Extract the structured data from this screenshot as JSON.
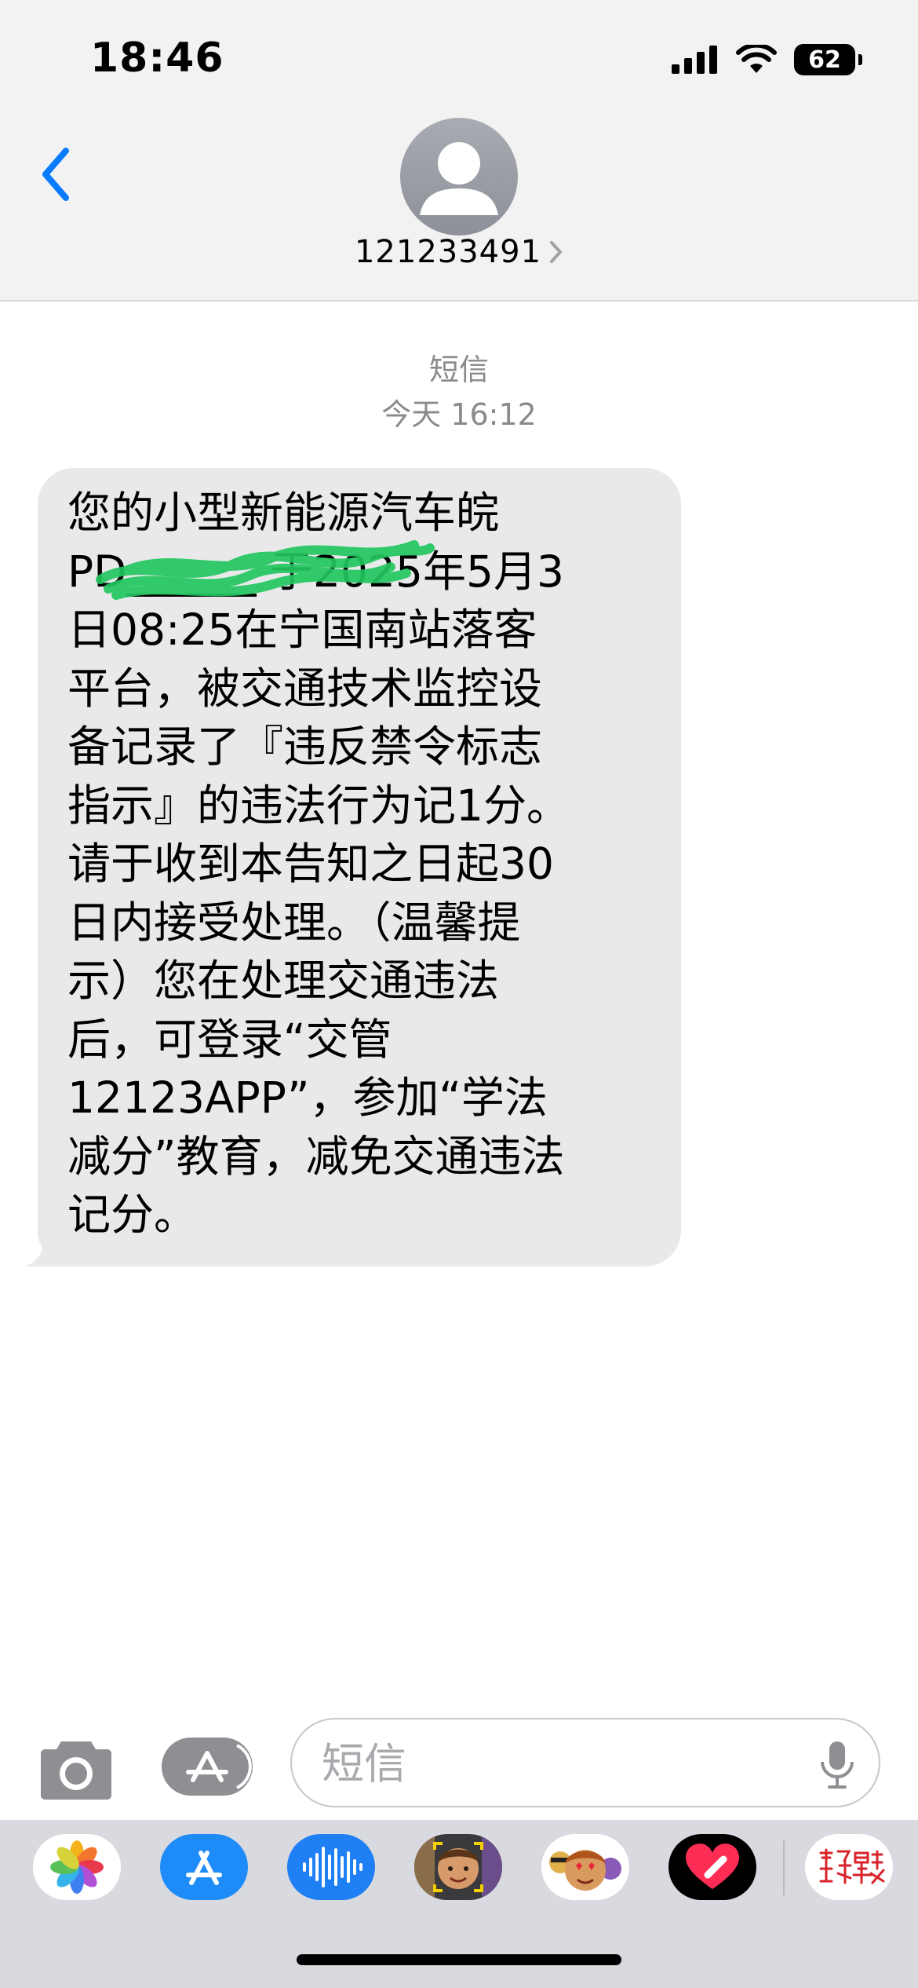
{
  "status_bar": {
    "time": "18:46",
    "battery_level": "62"
  },
  "nav": {
    "contact_number": "121233491"
  },
  "thread": {
    "service_label": "短信",
    "timestamp": "今天 16:12",
    "message": {
      "lines": [
        "您的小型新能源汽车皖",
        "PD______ 于2025年5月3",
        "日08:25在宁国南站落客",
        "平台，被交通技术监控设",
        "备记录了『违反禁令标志",
        "指示』的违法行为记1分。",
        "请于收到本告知之日起30",
        "日内接受处理。（温馨提",
        "示）您在处理交通违法",
        "后，可登录“交管",
        "12123APP”，参加“学法",
        "减分”教育，减免交通违法",
        "记分。"
      ]
    }
  },
  "composer": {
    "placeholder": "短信"
  },
  "app_drawer": {
    "apps": [
      "photos-icon",
      "app-store-icon",
      "audio-message-icon",
      "memoji-icon",
      "memoji-stickers-icon",
      "digital-touch-icon",
      "custom-sticker-app-icon"
    ]
  },
  "colors": {
    "accent": "#0a7aff",
    "bubble_received": "#e9e9eb",
    "meta_gray": "#8a8a8e",
    "redaction_scribble": "#22c55e"
  }
}
